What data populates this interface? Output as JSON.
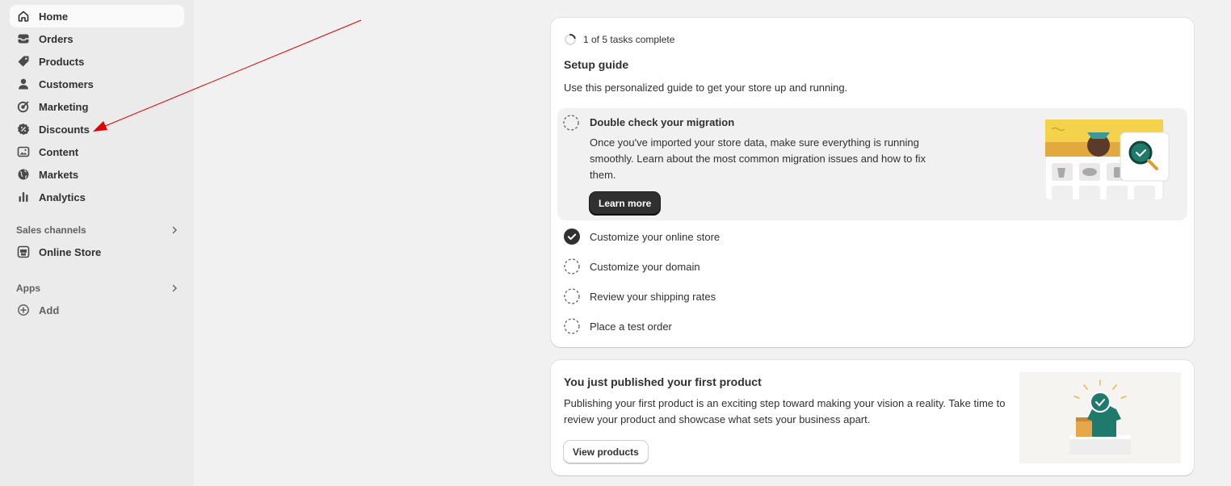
{
  "sidebar": {
    "items": [
      {
        "label": "Home",
        "icon": "home-icon"
      },
      {
        "label": "Orders",
        "icon": "inbox-icon"
      },
      {
        "label": "Products",
        "icon": "tag-icon"
      },
      {
        "label": "Customers",
        "icon": "person-icon"
      },
      {
        "label": "Marketing",
        "icon": "target-icon"
      },
      {
        "label": "Discounts",
        "icon": "discount-icon"
      },
      {
        "label": "Content",
        "icon": "image-icon"
      },
      {
        "label": "Markets",
        "icon": "globe-icon"
      },
      {
        "label": "Analytics",
        "icon": "bar-chart-icon"
      }
    ],
    "sales_channels": {
      "label": "Sales channels",
      "items": [
        {
          "label": "Online Store",
          "icon": "store-icon"
        }
      ]
    },
    "apps": {
      "label": "Apps",
      "add_label": "Add"
    }
  },
  "setup_guide": {
    "progress_text": "1 of 5 tasks complete",
    "tasks_complete": 1,
    "tasks_total": 5,
    "title": "Setup guide",
    "subtitle": "Use this personalized guide to get your store up and running.",
    "expanded_task": {
      "title": "Double check your migration",
      "description": "Once you've imported your store data, make sure everything is running smoothly. Learn about the most common migration issues and how to fix them.",
      "button_label": "Learn more"
    },
    "tasks": [
      {
        "label": "Customize your online store",
        "completed": true
      },
      {
        "label": "Customize your domain",
        "completed": false
      },
      {
        "label": "Review your shipping rates",
        "completed": false
      },
      {
        "label": "Place a test order",
        "completed": false
      }
    ]
  },
  "published_card": {
    "title": "You just published your first product",
    "description": "Publishing your first product is an exciting step toward making your vision a reality. Take time to review your product and showcase what sets your business apart.",
    "button_label": "View products"
  },
  "colors": {
    "sidebar_bg": "#ebebeb",
    "page_bg": "#f1f1f1",
    "text": "#303030",
    "annotation_arrow": "#e00000",
    "accent_teal": "#1f7a6b"
  }
}
